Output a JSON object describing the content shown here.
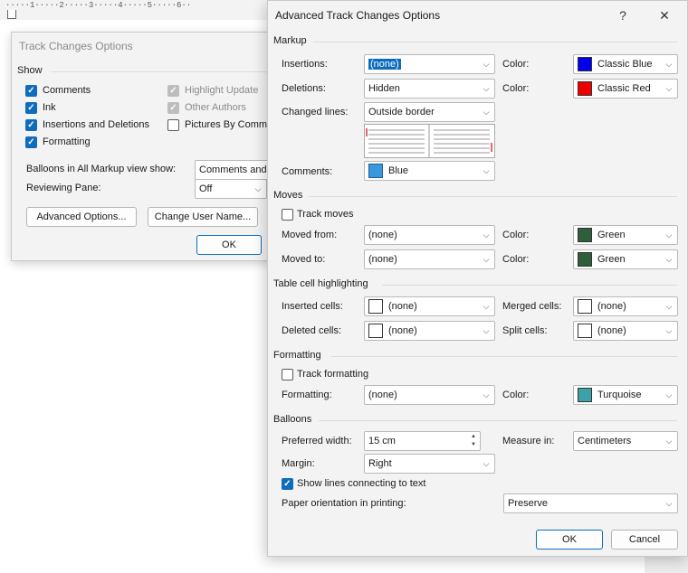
{
  "ruler": {
    "text": "·····1·····2·····3·····4·····5·····6··"
  },
  "track_changes_options": {
    "title": "Track Changes Options",
    "show_section": "Show",
    "checkboxes_left": [
      {
        "label": "Comments",
        "checked": true
      },
      {
        "label": "Ink",
        "checked": true
      },
      {
        "label": "Insertions and Deletions",
        "checked": true
      },
      {
        "label": "Formatting",
        "checked": true
      }
    ],
    "checkboxes_right": [
      {
        "label": "Highlight Update",
        "checked": true,
        "disabled": true
      },
      {
        "label": "Other Authors",
        "checked": true,
        "disabled": true
      },
      {
        "label": "Pictures By Comme",
        "checked": false,
        "disabled": false
      }
    ],
    "balloons_label": "Balloons in All Markup view show:",
    "balloons_value": "Comments and",
    "reviewing_pane_label": "Reviewing Pane:",
    "reviewing_pane_value": "Off",
    "advanced_button": "Advanced Options...",
    "change_user_button": "Change User Name...",
    "ok_button": "OK"
  },
  "advanced": {
    "title": "Advanced Track Changes Options",
    "help": "?",
    "close": "✕",
    "markup": {
      "section": "Markup",
      "insertions_label": "Insertions:",
      "insertions_value": "(none)",
      "deletions_label": "Deletions:",
      "deletions_value": "Hidden",
      "changed_lines_label": "Changed lines:",
      "changed_lines_value": "Outside border",
      "comments_label": "Comments:",
      "comments_value": "Blue",
      "comments_color": "#3a96dd",
      "color_label": "Color:",
      "insertions_color_name": "Classic Blue",
      "insertions_color": "#0000ee",
      "deletions_color_name": "Classic Red",
      "deletions_color": "#ee0000"
    },
    "moves": {
      "section": "Moves",
      "track_moves_label": "Track moves",
      "track_moves_checked": false,
      "moved_from_label": "Moved from:",
      "moved_from_value": "(none)",
      "moved_to_label": "Moved to:",
      "moved_to_value": "(none)",
      "color_label": "Color:",
      "from_color_name": "Green",
      "to_color_name": "Green",
      "green_color": "#2e5e3a"
    },
    "table": {
      "section": "Table cell highlighting",
      "inserted_label": "Inserted cells:",
      "inserted_value": "(none)",
      "deleted_label": "Deleted cells:",
      "deleted_value": "(none)",
      "merged_label": "Merged cells:",
      "merged_value": "(none)",
      "split_label": "Split cells:",
      "split_value": "(none)"
    },
    "formatting": {
      "section": "Formatting",
      "track_formatting_label": "Track formatting",
      "track_formatting_checked": false,
      "formatting_label": "Formatting:",
      "formatting_value": "(none)",
      "color_label": "Color:",
      "color_name": "Turquoise",
      "color": "#3ba3a8"
    },
    "balloons": {
      "section": "Balloons",
      "preferred_width_label": "Preferred width:",
      "preferred_width_value": "15 cm",
      "measure_in_label": "Measure in:",
      "measure_in_value": "Centimeters",
      "margin_label": "Margin:",
      "margin_value": "Right",
      "show_lines_label": "Show lines connecting to text",
      "show_lines_checked": true,
      "paper_orientation_label": "Paper orientation in printing:",
      "paper_orientation_value": "Preserve"
    },
    "ok_button": "OK",
    "cancel_button": "Cancel"
  }
}
